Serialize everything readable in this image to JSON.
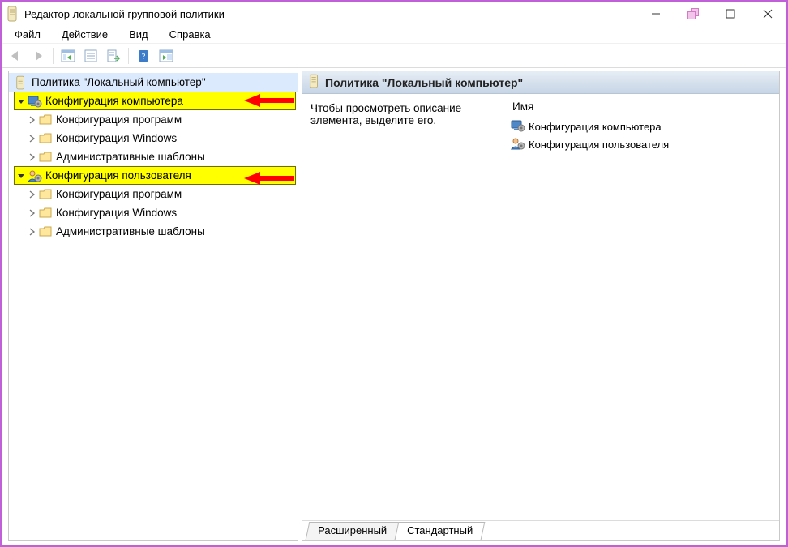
{
  "title": "Редактор локальной групповой политики",
  "menu": {
    "file": "Файл",
    "action": "Действие",
    "view": "Вид",
    "help": "Справка"
  },
  "toolbar": {
    "back": "back",
    "forward": "forward",
    "up": "up",
    "refresh": "refresh",
    "export": "export",
    "help": "help",
    "show": "show"
  },
  "tree": {
    "root": "Политика \"Локальный компьютер\"",
    "computer": {
      "label": "Конфигурация компьютера",
      "children": {
        "software": "Конфигурация программ",
        "windows": "Конфигурация Windows",
        "admtemplates": "Административные шаблоны"
      }
    },
    "user": {
      "label": "Конфигурация пользователя",
      "children": {
        "software": "Конфигурация программ",
        "windows": "Конфигурация Windows",
        "admtemplates": "Административные шаблоны"
      }
    }
  },
  "right": {
    "header": "Политика \"Локальный компьютер\"",
    "description": "Чтобы просмотреть описание элемента, выделите его.",
    "column_name": "Имя",
    "items": {
      "computer": "Конфигурация компьютера",
      "user": "Конфигурация пользователя"
    }
  },
  "tabs": {
    "extended": "Расширенный",
    "standard": "Стандартный"
  }
}
